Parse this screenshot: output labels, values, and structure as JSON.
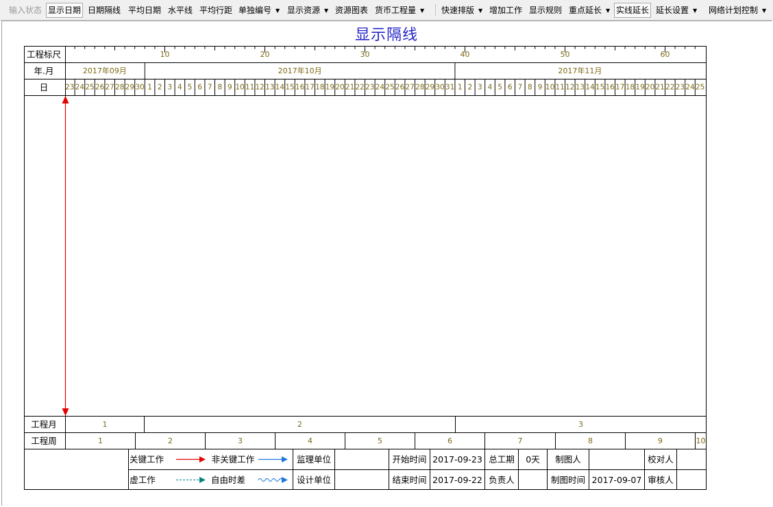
{
  "toolbar": {
    "items": [
      {
        "label": "输入状态",
        "disabled": true
      },
      {
        "label": "显示日期",
        "pressed": true
      },
      {
        "label": "日期隔线"
      },
      {
        "label": "平均日期"
      },
      {
        "label": "水平线"
      },
      {
        "label": "平均行距"
      },
      {
        "label": "单独编号",
        "dropdown": true
      },
      {
        "label": "显示资源",
        "dropdown": true
      },
      {
        "label": "资源图表"
      },
      {
        "label": "货币工程量",
        "dropdown": true
      },
      {
        "label": "快速排版",
        "dropdown": true
      },
      {
        "label": "增加工作"
      },
      {
        "label": "显示规则"
      },
      {
        "label": "重点延长",
        "dropdown": true
      },
      {
        "label": "实线延长",
        "pressed": true
      },
      {
        "label": "延长设置",
        "dropdown": true
      },
      {
        "label": "网络计划控制",
        "dropdown": true
      }
    ]
  },
  "document": {
    "title": "显示隔线",
    "row_labels": {
      "scale": "工程标尺",
      "year_month": "年.月",
      "day": "日",
      "project_month": "工程月",
      "project_week": "工程周"
    },
    "scale_ticks": [
      "10",
      "20",
      "30",
      "40",
      "50",
      "60"
    ],
    "months": [
      "2017年09月",
      "2017年10月",
      "2017年11月"
    ],
    "days": [
      "23",
      "24",
      "25",
      "26",
      "27",
      "28",
      "29",
      "30",
      "1",
      "2",
      "3",
      "4",
      "5",
      "6",
      "7",
      "8",
      "9",
      "10",
      "11",
      "12",
      "13",
      "14",
      "15",
      "16",
      "17",
      "18",
      "19",
      "20",
      "21",
      "22",
      "23",
      "24",
      "25",
      "26",
      "27",
      "28",
      "29",
      "30",
      "31",
      "1",
      "2",
      "3",
      "4",
      "5",
      "6",
      "7",
      "8",
      "9",
      "10",
      "11",
      "12",
      "13",
      "14",
      "15",
      "16",
      "17",
      "18",
      "19",
      "20",
      "21",
      "22",
      "23",
      "24",
      "25"
    ],
    "project_months": [
      "1",
      "2",
      "3"
    ],
    "project_weeks": [
      "1",
      "2",
      "3",
      "4",
      "5",
      "6",
      "7",
      "8",
      "9",
      "10"
    ]
  },
  "legend": {
    "critical_work": "关键工作",
    "noncritical_work": "非关键工作",
    "dummy_work": "虚工作",
    "free_float": "自由时差",
    "supervisor_unit": "监理单位",
    "supervisor_unit_value": "",
    "design_unit": "设计单位",
    "design_unit_value": "",
    "start_time": "开始时间",
    "start_time_value": "2017-09-23",
    "end_time": "结束时间",
    "end_time_value": "2017-09-22",
    "total_duration": "总工期",
    "total_duration_value": "0天",
    "responsible": "负责人",
    "responsible_value": "",
    "drafter": "制图人",
    "drafter_value": "",
    "draw_time": "制图时间",
    "draw_time_value": "2017-09-07",
    "checker": "校对人",
    "checker_value": "",
    "reviewer": "审核人",
    "reviewer_value": ""
  },
  "colors": {
    "critical": "#e60000",
    "noncritical": "#1e78dc",
    "dummy": "#008080",
    "title": "#2323c8",
    "scale_text": "#7b6914"
  }
}
